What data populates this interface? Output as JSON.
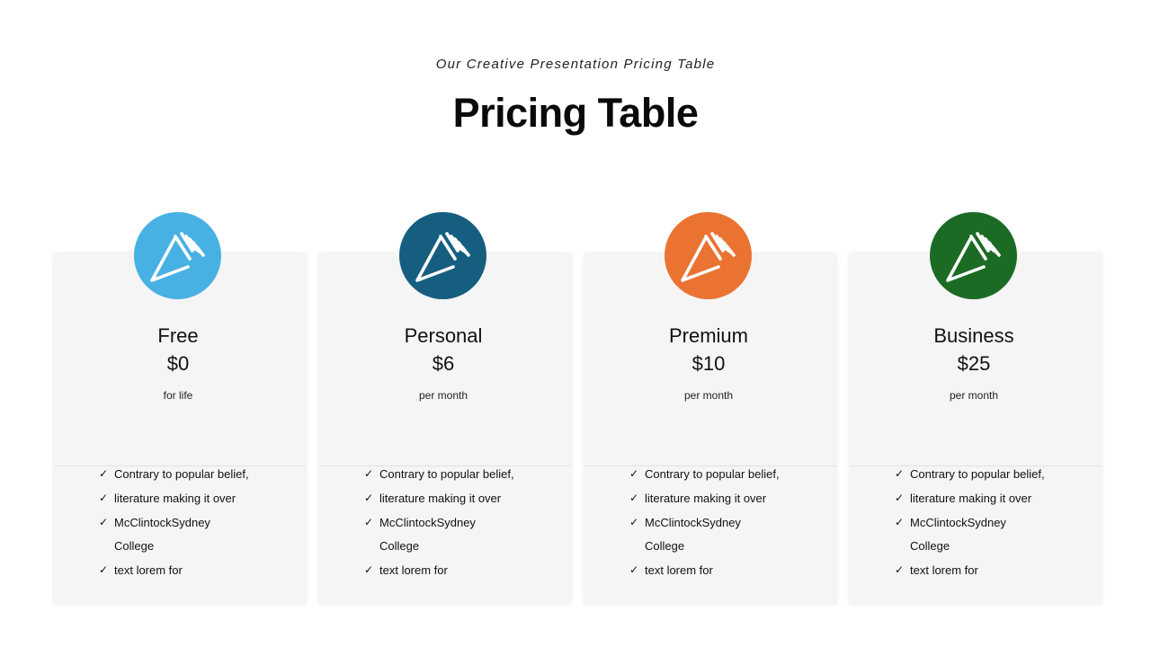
{
  "header": {
    "subtitle": "Our Creative Presentation Pricing Table",
    "title": "Pricing Table"
  },
  "icon": "pencil-icon",
  "check_icon": "✓",
  "plans": [
    {
      "name": "Free",
      "price": "$0",
      "period": "for life",
      "color": "#48B1E3",
      "features": [
        "Contrary to popular belief,",
        "literature making it over",
        "McClintockSydney",
        "College",
        "text lorem for"
      ]
    },
    {
      "name": "Personal",
      "price": "$6",
      "period": "per month",
      "color": "#165E7F",
      "features": [
        "Contrary to popular belief,",
        "literature making it over",
        "McClintockSydney",
        "College",
        "text lorem for"
      ]
    },
    {
      "name": "Premium",
      "price": "$10",
      "period": "per month",
      "color": "#EA7332",
      "features": [
        "Contrary to popular belief,",
        "literature making it over",
        "McClintockSydney",
        "College",
        "text lorem for"
      ]
    },
    {
      "name": "Business",
      "price": "$25",
      "period": "per month",
      "color": "#1B6B24",
      "features": [
        "Contrary to popular belief,",
        "literature making it over",
        "McClintockSydney",
        "College",
        "text lorem for"
      ]
    }
  ]
}
